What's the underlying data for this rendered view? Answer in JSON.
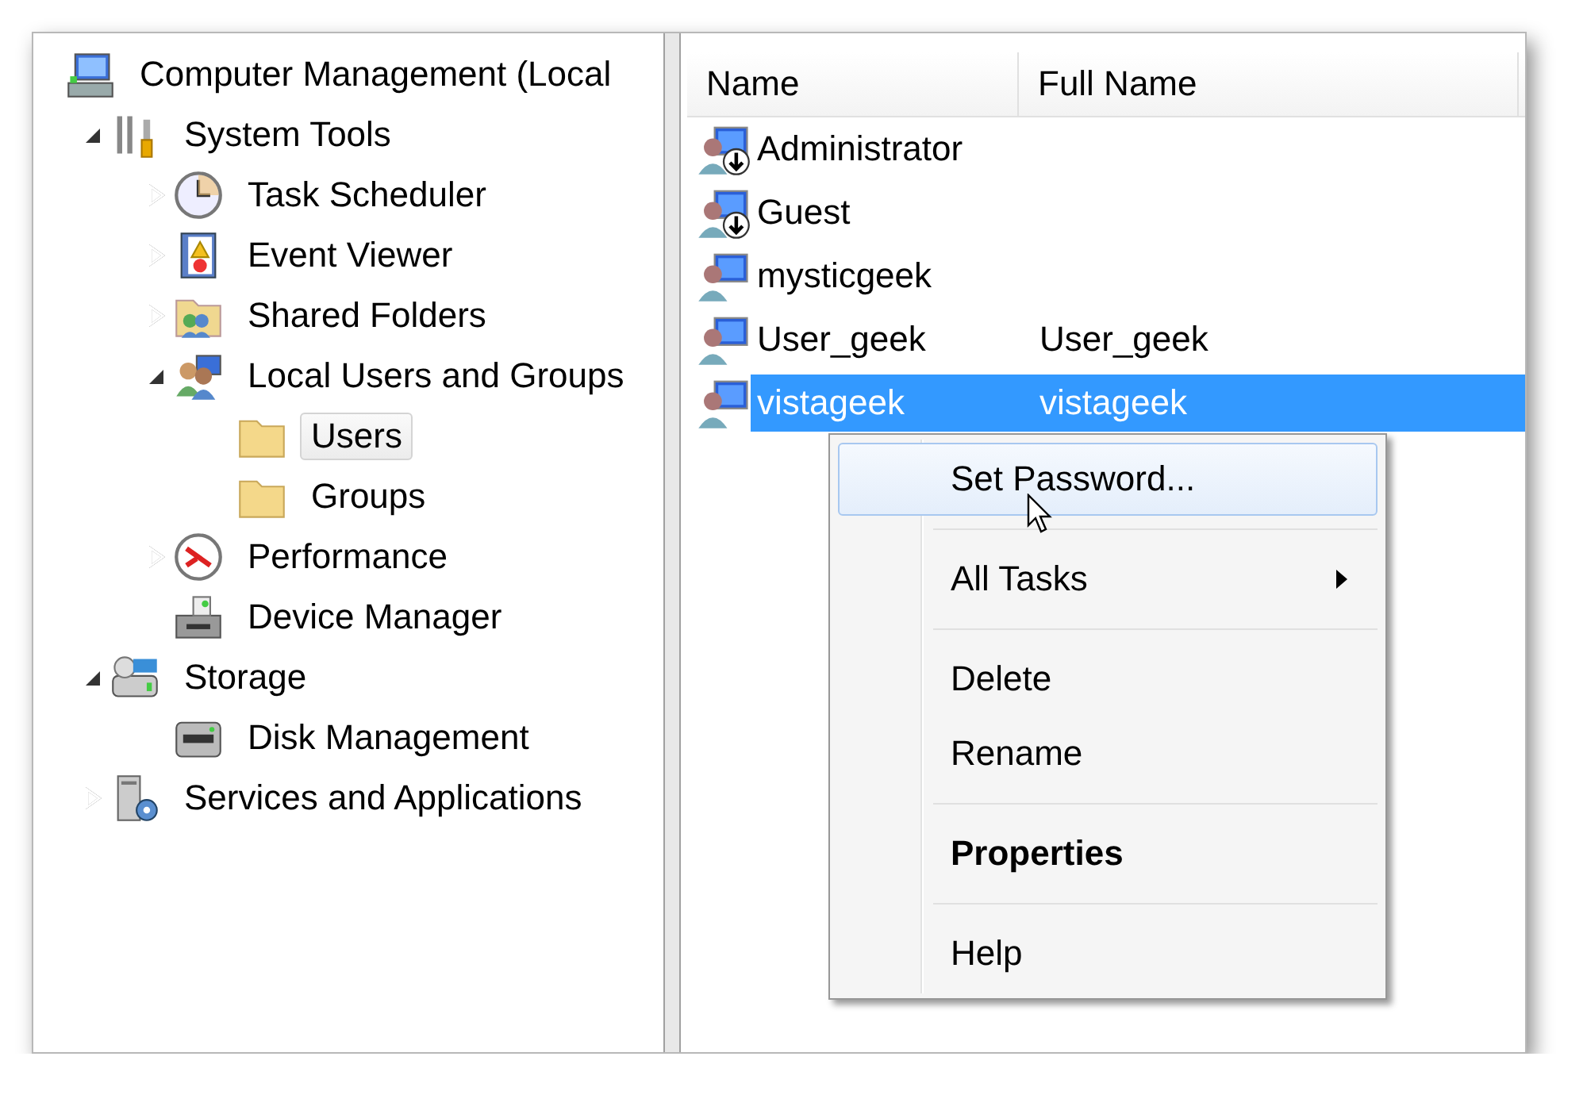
{
  "tree": [
    {
      "label": "Computer Management (Local",
      "kind": "computer",
      "children": [
        {
          "label": "System Tools",
          "kind": "tools",
          "expanded": true,
          "children": [
            {
              "label": "Task Scheduler",
              "kind": "clock",
              "expanded": false
            },
            {
              "label": "Event Viewer",
              "kind": "log",
              "expanded": false
            },
            {
              "label": "Shared Folders",
              "kind": "shared",
              "expanded": false
            },
            {
              "label": "Local Users and Groups",
              "kind": "users",
              "expanded": true,
              "children": [
                {
                  "label": "Users",
                  "kind": "folder",
                  "selected": true
                },
                {
                  "label": "Groups",
                  "kind": "folder",
                  "selected": false
                }
              ]
            },
            {
              "label": "Performance",
              "kind": "gauge",
              "expanded": false
            },
            {
              "label": "Device Manager",
              "kind": "device"
            }
          ]
        },
        {
          "label": "Storage",
          "kind": "storage",
          "expanded": true,
          "children": [
            {
              "label": "Disk Management",
              "kind": "disk"
            }
          ]
        },
        {
          "label": "Services and Applications",
          "kind": "server",
          "expanded": false
        }
      ]
    }
  ],
  "table": {
    "columns": [
      "Name",
      "Full Name"
    ],
    "rows": [
      {
        "name": "Administrator",
        "account_disabled": true,
        "selected": false
      },
      {
        "name": "Guest",
        "account_disabled": true,
        "selected": false
      },
      {
        "name": "mysticgeek",
        "account_disabled": false,
        "selected": false
      },
      {
        "name": "User_geek",
        "full_name": "User_geek",
        "account_disabled": false,
        "selected": false
      },
      {
        "name": "vistageek",
        "full_name": "vistageek",
        "account_disabled": false,
        "selected": true
      }
    ]
  },
  "context_menu": {
    "items": [
      {
        "kind": "item",
        "label": "Set Password...",
        "hovered": true
      },
      {
        "kind": "separator"
      },
      {
        "kind": "submenu",
        "label": "All Tasks",
        "hovered": false
      },
      {
        "kind": "separator"
      },
      {
        "kind": "item",
        "label": "Delete",
        "hovered": false
      },
      {
        "kind": "item",
        "label": "Rename",
        "hovered": false
      },
      {
        "kind": "separator"
      },
      {
        "kind": "default",
        "label": "Properties",
        "hovered": false
      },
      {
        "kind": "separator"
      },
      {
        "kind": "item",
        "label": "Help",
        "hovered": false
      }
    ]
  }
}
